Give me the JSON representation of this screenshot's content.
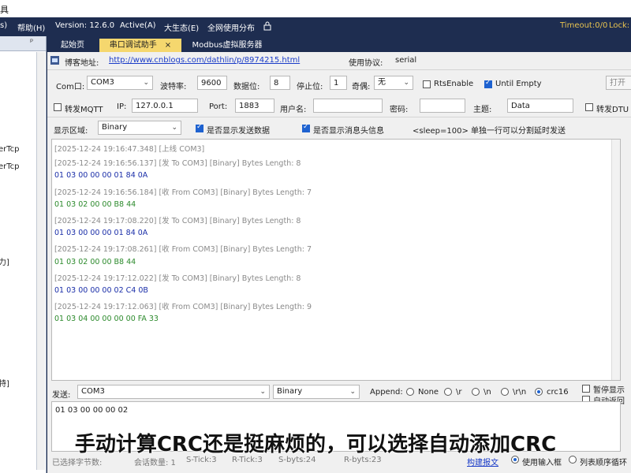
{
  "window": {
    "title_fragment": "具"
  },
  "menubar": {
    "items": [
      "s)",
      "帮助(H)",
      "Version: 12.6.0",
      "Active(A)",
      "大生态(E)",
      "全网使用分布"
    ],
    "lock_icon": "lock-icon",
    "timeout": "Timeout:0/0",
    "lock_label": "Lock:"
  },
  "sidebar": {
    "pin_glyph": "ᵖ",
    "items": [
      "erTcp",
      "erTcp",
      "力]",
      "特]"
    ]
  },
  "tabs": [
    {
      "label": "起始页"
    },
    {
      "label": "串口调试助手",
      "close": "×"
    },
    {
      "label": "Modbus虚拟服务器"
    }
  ],
  "blog": {
    "label": "博客地址:",
    "url": "http://www.cnblogs.com/dathlin/p/8974215.html",
    "protocol_label": "使用协议:",
    "protocol_value": "serial"
  },
  "serial": {
    "com_label": "Com口:",
    "com_value": "COM3",
    "baud_label": "波特率:",
    "baud_value": "9600",
    "databits_label": "数据位:",
    "databits_value": "8",
    "stopbits_label": "停止位:",
    "stopbits_value": "1",
    "parity_label": "奇偶:",
    "parity_value": "无",
    "rts_label": "RtsEnable",
    "rts_checked": false,
    "until_empty_label": "Until Empty",
    "until_empty_checked": true,
    "open_button": "打开"
  },
  "mqtt": {
    "forward_label": "转发MQTT",
    "ip_label": "IP:",
    "ip_value": "127.0.0.1",
    "port_label": "Port:",
    "port_value": "1883",
    "user_label": "用户名:",
    "user_value": "",
    "pwd_label": "密码:",
    "pwd_value": "",
    "topic_label": "主题:",
    "topic_value": "Data",
    "dtu_label": "转发DTU"
  },
  "display": {
    "area_label": "显示区域:",
    "area_value": "Binary",
    "show_send_label": "是否显示发送数据",
    "show_send_checked": true,
    "show_header_label": "是否显示消息头信息",
    "show_header_checked": true,
    "sleep_hint": "<sleep=100> 单独一行可以分割延时发送"
  },
  "log": [
    {
      "type": "meta",
      "text": "[2025-12-24 19:16:47.348] [上线 COM3]"
    },
    {
      "type": "meta",
      "text": "[2025-12-24 19:16:56.137] [发 To COM3]  [Binary]  Bytes Length: 8"
    },
    {
      "type": "send",
      "text": "01 03 00 00 00 01 84 0A"
    },
    {
      "type": "meta",
      "text": "[2025-12-24 19:16:56.184] [收 From COM3]  [Binary]  Bytes Length: 7"
    },
    {
      "type": "recv",
      "text": "01 03 02 00 00 B8 44"
    },
    {
      "type": "meta",
      "text": "[2025-12-24 19:17:08.220] [发 To COM3]  [Binary]  Bytes Length: 8"
    },
    {
      "type": "send",
      "text": "01 03 00 00 00 01 84 0A"
    },
    {
      "type": "meta",
      "text": "[2025-12-24 19:17:08.261] [收 From COM3]  [Binary]  Bytes Length: 7"
    },
    {
      "type": "recv",
      "text": "01 03 02 00 00 B8 44"
    },
    {
      "type": "meta",
      "text": "[2025-12-24 19:17:12.022] [发 To COM3]  [Binary]  Bytes Length: 8"
    },
    {
      "type": "send",
      "text": "01 03 00 00 00 02 C4 0B"
    },
    {
      "type": "meta",
      "text": "[2025-12-24 19:17:12.063] [收 From COM3]  [Binary]  Bytes Length: 9"
    },
    {
      "type": "recv",
      "text": "01 03 04 00 00 00 00 FA 33"
    }
  ],
  "send": {
    "label": "发送:",
    "target": "COM3",
    "format": "Binary",
    "append_label": "Append:",
    "append_options": [
      "None",
      "\\r",
      "\\n",
      "\\r\\n",
      "crc16"
    ],
    "append_selected": "crc16",
    "pause_label": "暂停显示",
    "auto_reply_label": "自动返回",
    "input_value": "01 03 00 00 00 02"
  },
  "status": {
    "selected_bytes": "已选择字节数:",
    "sessions": "会话数量: 1",
    "s_tick": "S-Tick:3",
    "r_tick": "R-Tick:3",
    "s_byts": "S-byts:24",
    "r_byts": "R-byts:23",
    "build_report": "构建报文",
    "use_input_label": "使用输入框",
    "list_loop_label": "列表顺序循环"
  },
  "subtitle": "手动计算CRC还是挺麻烦的，可以选择自动添加CRC",
  "colors": {
    "menubar_bg": "#1e2d50",
    "active_tab": "#f5d76e",
    "timeout_text": "#e8c34f",
    "send_text": "#1a2ea8",
    "recv_text": "#2c8a2c",
    "link": "#1a3cc8"
  }
}
